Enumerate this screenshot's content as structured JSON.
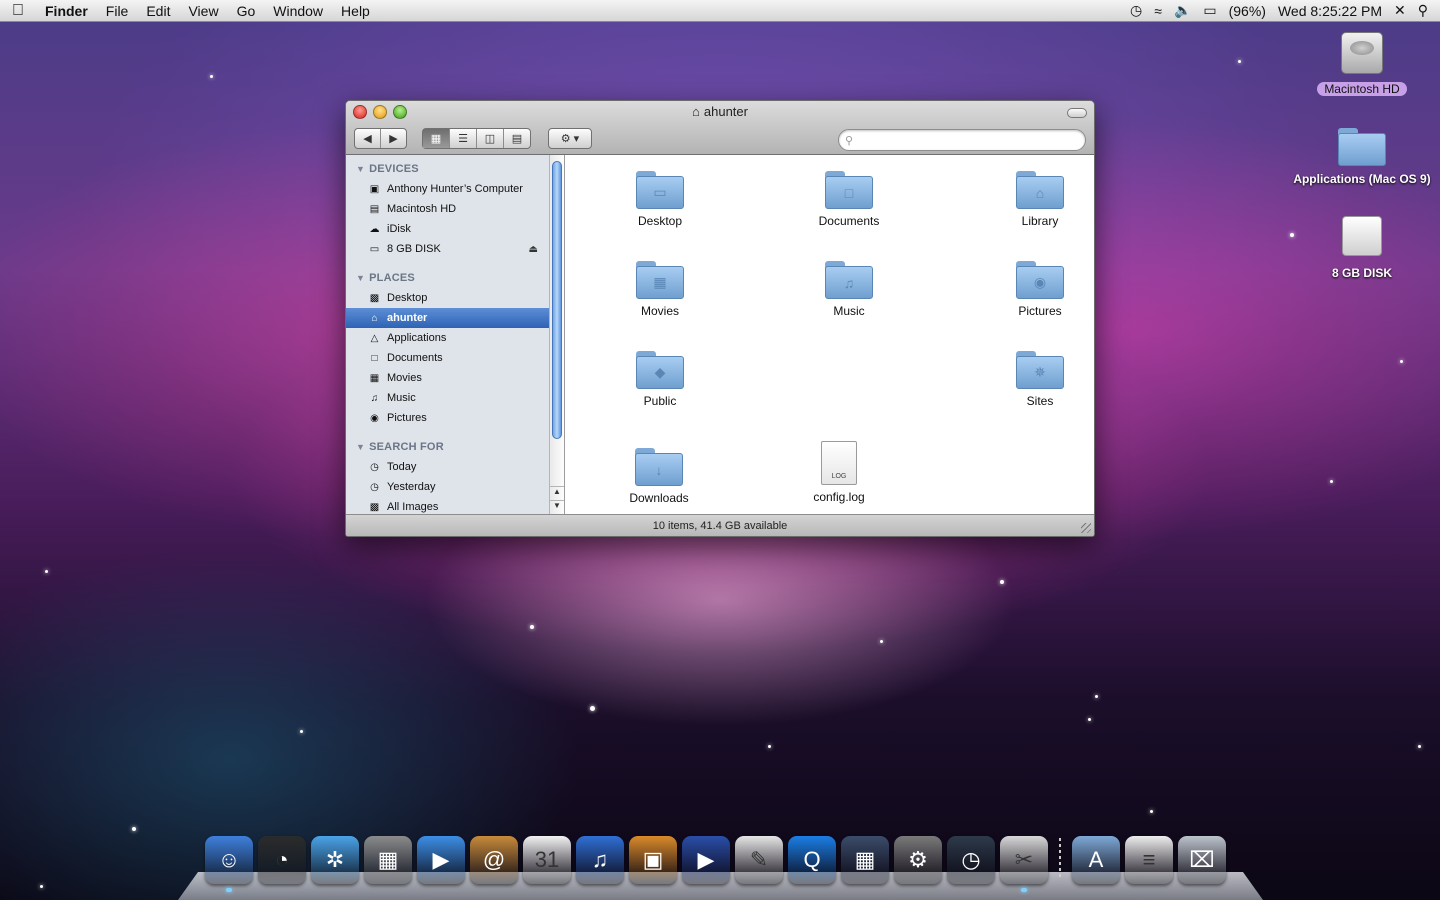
{
  "menubar": {
    "apple": "",
    "app": "Finder",
    "menus": [
      "File",
      "Edit",
      "View",
      "Go",
      "Window",
      "Help"
    ],
    "battery": "(96%)",
    "clock": "Wed 8:25:22 PM"
  },
  "desktop": {
    "icons": [
      {
        "label": "Macintosh HD",
        "icon": "hard-drive-icon"
      },
      {
        "label": "Applications (Mac OS 9)",
        "icon": "folder-icon"
      },
      {
        "label": "8 GB DISK",
        "icon": "disk-icon"
      }
    ]
  },
  "window": {
    "title": "ahunter",
    "search_placeholder": "",
    "status": "10 items, 41.4 GB available",
    "view_mode": "icon"
  },
  "sidebar": {
    "sections": [
      {
        "heading": "DEVICES",
        "items": [
          {
            "label": "Anthony Hunter’s Computer",
            "icon": "computer-icon"
          },
          {
            "label": "Macintosh HD",
            "icon": "hard-drive-icon"
          },
          {
            "label": "iDisk",
            "icon": "idisk-icon"
          },
          {
            "label": "8 GB DISK",
            "icon": "disk-icon"
          }
        ]
      },
      {
        "heading": "PLACES",
        "items": [
          {
            "label": "Desktop",
            "icon": "desktop-icon"
          },
          {
            "label": "ahunter",
            "icon": "home-icon",
            "selected": true
          },
          {
            "label": "Applications",
            "icon": "applications-icon"
          },
          {
            "label": "Documents",
            "icon": "documents-icon"
          },
          {
            "label": "Movies",
            "icon": "movies-icon"
          },
          {
            "label": "Music",
            "icon": "music-icon"
          },
          {
            "label": "Pictures",
            "icon": "pictures-icon"
          }
        ]
      },
      {
        "heading": "SEARCH FOR",
        "items": [
          {
            "label": "Today",
            "icon": "clock-icon"
          },
          {
            "label": "Yesterday",
            "icon": "clock-icon"
          },
          {
            "label": "All Images",
            "icon": "images-icon"
          }
        ]
      }
    ]
  },
  "files": [
    {
      "name": "Desktop",
      "kind": "folder",
      "glyph": "▭"
    },
    {
      "name": "Documents",
      "kind": "folder",
      "glyph": "□"
    },
    {
      "name": "Library",
      "kind": "folder",
      "glyph": "⌂"
    },
    {
      "name": "Movies",
      "kind": "folder",
      "glyph": "▦"
    },
    {
      "name": "Music",
      "kind": "folder",
      "glyph": "♫"
    },
    {
      "name": "Pictures",
      "kind": "folder",
      "glyph": "◉"
    },
    {
      "name": "Public",
      "kind": "folder",
      "glyph": "◆"
    },
    {
      "name": "Sites",
      "kind": "folder",
      "glyph": "✵"
    },
    {
      "name": "Downloads",
      "kind": "folder",
      "glyph": "↓"
    },
    {
      "name": "config.log",
      "kind": "document",
      "tag": "LOG"
    }
  ],
  "dock": {
    "apps": [
      {
        "name": "Finder",
        "icon": "finder-icon",
        "color": "#3f7fdc",
        "glyph": "☺",
        "running": true
      },
      {
        "name": "Dashboard",
        "icon": "dashboard-icon",
        "color": "#2b2b2b",
        "glyph": "◔"
      },
      {
        "name": "Safari",
        "icon": "safari-icon",
        "color": "#4aa3e8",
        "glyph": "✲"
      },
      {
        "name": "Calculator",
        "icon": "calculator-icon",
        "color": "#8b8b8b",
        "glyph": "▦"
      },
      {
        "name": "iChat",
        "icon": "ichat-icon",
        "color": "#3d8ee6",
        "glyph": "▶"
      },
      {
        "name": "Address Book",
        "icon": "address-book-icon",
        "color": "#c88a3a",
        "glyph": "@"
      },
      {
        "name": "iCal",
        "icon": "ical-icon",
        "color": "#f2f2f2",
        "glyph": "31"
      },
      {
        "name": "iTunes",
        "icon": "itunes-icon",
        "color": "#2f6fd4",
        "glyph": "♫"
      },
      {
        "name": "iPhoto",
        "icon": "iphoto-icon",
        "color": "#d98a2a",
        "glyph": "▣"
      },
      {
        "name": "iMovie",
        "icon": "imovie-icon",
        "color": "#2a4ea8",
        "glyph": "▶"
      },
      {
        "name": "Preview",
        "icon": "preview-icon",
        "color": "#e6e6e6",
        "glyph": "✎"
      },
      {
        "name": "QuickTime",
        "icon": "quicktime-icon",
        "color": "#1b7ee6",
        "glyph": "Q"
      },
      {
        "name": "Spaces",
        "icon": "spaces-icon",
        "color": "#3a4c6a",
        "glyph": "▦"
      },
      {
        "name": "System Preferences",
        "icon": "system-preferences-icon",
        "color": "#7a7a7a",
        "glyph": "⚙"
      },
      {
        "name": "Time Machine",
        "icon": "time-machine-icon",
        "color": "#2d3a4a",
        "glyph": "◷"
      },
      {
        "name": "Grab",
        "icon": "grab-icon",
        "color": "#d8d8d8",
        "glyph": "✂",
        "running": true
      }
    ],
    "stacks": [
      {
        "name": "Applications",
        "icon": "applications-stack-icon",
        "color": "#7ea9d6",
        "glyph": "A"
      },
      {
        "name": "Documents",
        "icon": "documents-stack-icon",
        "color": "#eeeeee",
        "glyph": "≡"
      },
      {
        "name": "Trash",
        "icon": "trash-icon",
        "color": "#bcc4cc",
        "glyph": "⌧"
      }
    ]
  }
}
